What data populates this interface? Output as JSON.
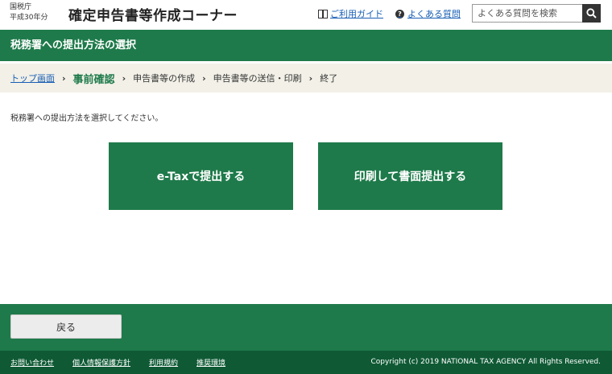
{
  "header": {
    "agency": "国税庁",
    "year": "平成30年分",
    "title": "確定申告書等作成コーナー",
    "guide_link": "ご利用ガイド",
    "faq_link": "よくある質問",
    "search_placeholder": "よくある質問を検索"
  },
  "page_title": "税務署への提出方法の選択",
  "breadcrumb": {
    "items": [
      "トップ画面",
      "事前確認",
      "申告書等の作成",
      "申告書等の送信・印刷",
      "終了"
    ],
    "current_index": 1
  },
  "main": {
    "instruction": "税務署への提出方法を選択してください。",
    "etax_button": "e-Taxで提出する",
    "print_button": "印刷して書面提出する"
  },
  "footer": {
    "back_button": "戻る",
    "links": [
      "お問い合わせ",
      "個人情報保護方針",
      "利用規約",
      "推奨環境"
    ],
    "copyright": "Copyright (c) 2019 NATIONAL TAX AGENCY All Rights Reserved."
  },
  "colors": {
    "primary_green": "#1e7a4a",
    "dark_green": "#0f5a35",
    "breadcrumb_bg": "#f2f0e7",
    "link_blue": "#1a5fb4"
  },
  "icons": {
    "guide": "book-icon",
    "faq": "question-circle-icon",
    "search": "search-icon"
  }
}
